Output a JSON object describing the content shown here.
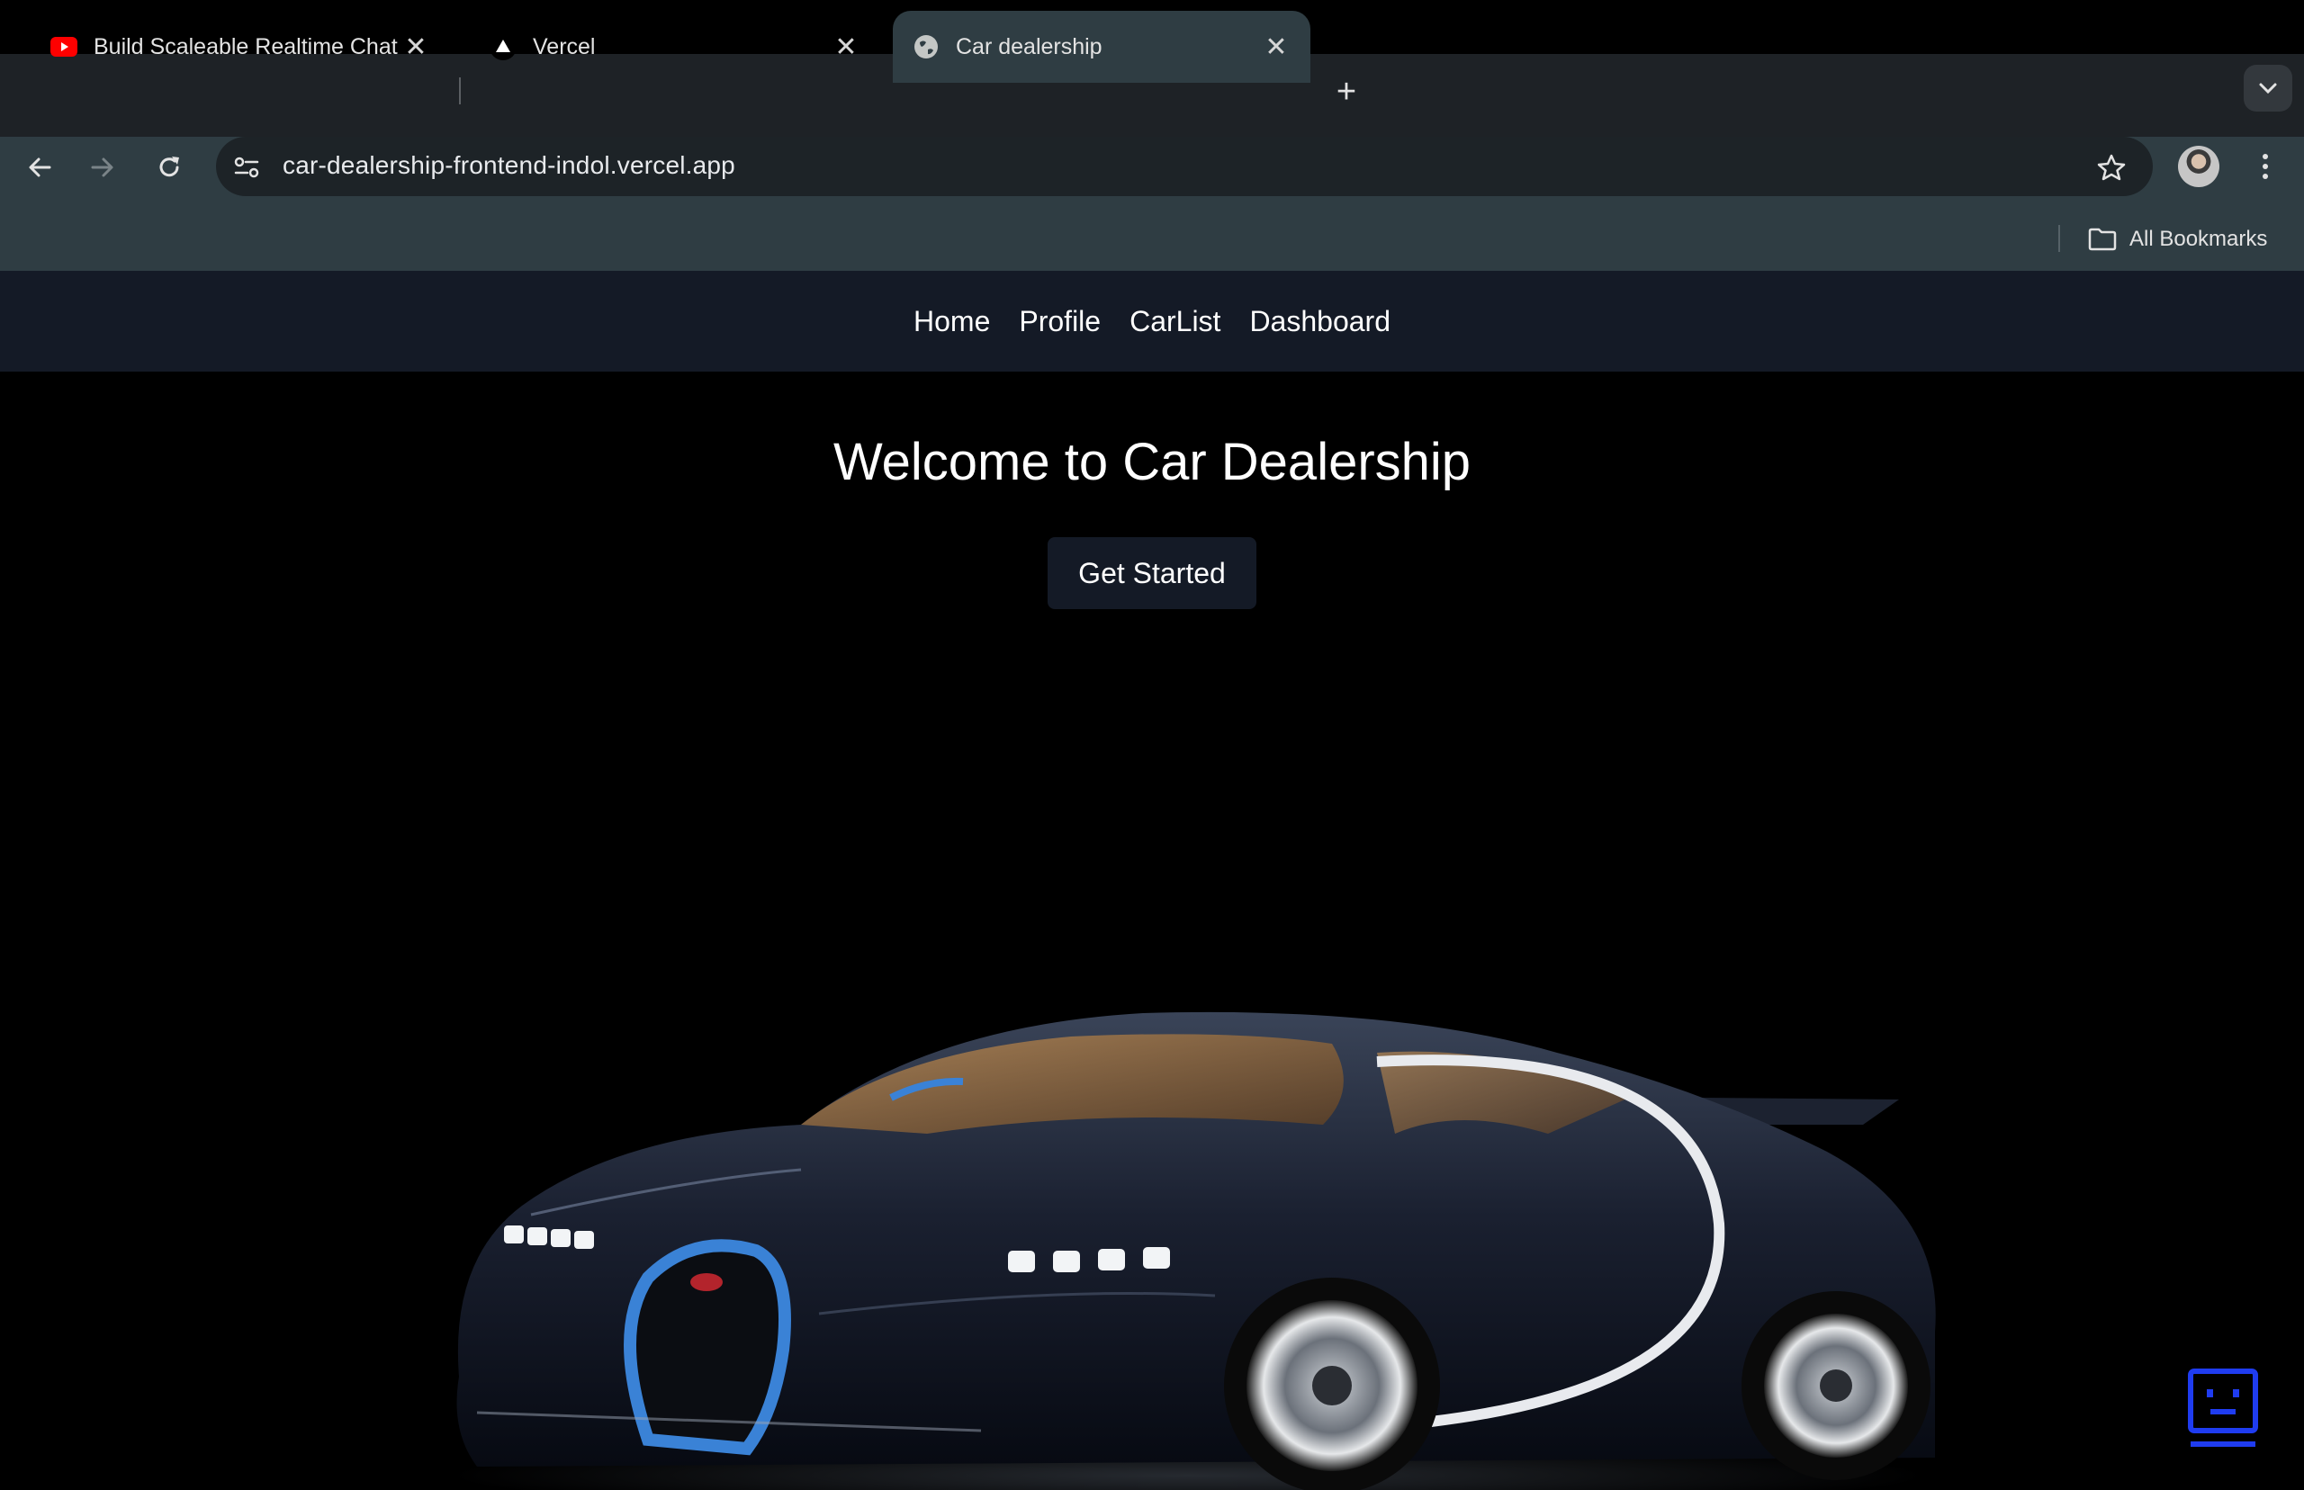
{
  "browser": {
    "tabs": [
      {
        "title": "Build Scaleable Realtime Chat",
        "icon": "youtube-icon",
        "active": false
      },
      {
        "title": "Vercel",
        "icon": "vercel-triangle-icon",
        "active": false
      },
      {
        "title": "Car dealership",
        "icon": "globe-icon",
        "active": true
      }
    ],
    "url": "car-dealership-frontend-indol.vercel.app",
    "bookmarks_label": "All Bookmarks"
  },
  "site": {
    "nav": [
      "Home",
      "Profile",
      "CarList",
      "Dashboard"
    ],
    "hero_title": "Welcome to Car Dealership",
    "cta_label": "Get Started"
  },
  "colors": {
    "page_bg": "#000000",
    "nav_bg": "#141a26",
    "chrome_tabbar": "#1e2226",
    "chrome_toolbar": "#2f3d43",
    "car_accent": "#3a82d6"
  }
}
